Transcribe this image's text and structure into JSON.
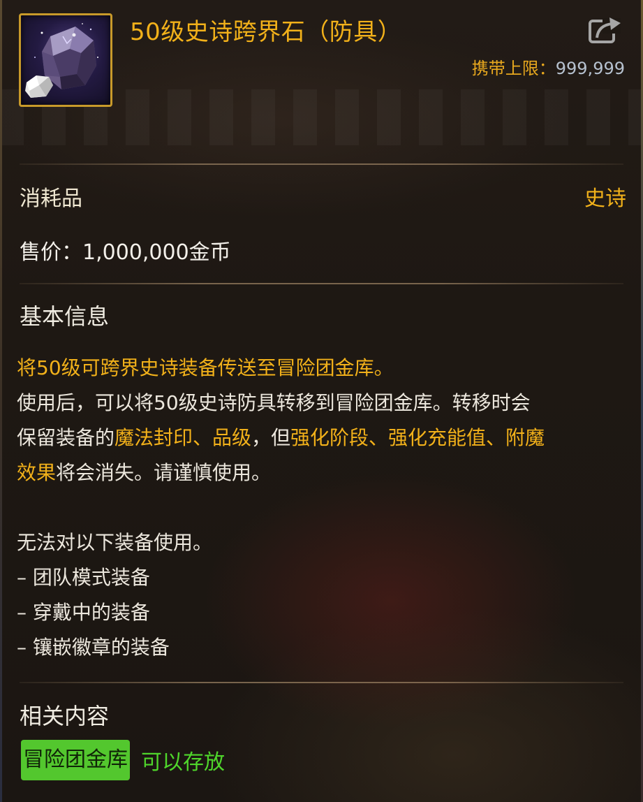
{
  "item": {
    "title": "50级史诗跨界石（防具）",
    "carry_label": "携带上限：",
    "carry_value": "999,999",
    "icon": "stone-icon"
  },
  "info": {
    "category": "消耗品",
    "rarity": "史诗",
    "price": "售价：1,000,000金币"
  },
  "basic": {
    "heading": "基本信息",
    "line1": "将50级可跨界史诗装备传送至冒险团金库。",
    "line2": "使用后，可以将50级史诗防具转移到冒险团金库。转移时会",
    "line3a": "保留装备的",
    "line3b": "魔法封印、品级",
    "line3c": "，但",
    "line3d": "强化阶段、强化充能值、附魔",
    "line4a": "效果",
    "line4b": "将会消失。请谨慎使用。",
    "restrict": "无法对以下装备使用。",
    "items": [
      "– 团队模式装备",
      "– 穿戴中的装备",
      "– 镶嵌徽章的装备"
    ]
  },
  "related": {
    "heading": "相关内容",
    "tag": "冒险团金库",
    "status": "可以存放"
  },
  "colors": {
    "gold": "#f2b11a",
    "green": "#4fd62b",
    "tag_bg": "#53c72e"
  }
}
